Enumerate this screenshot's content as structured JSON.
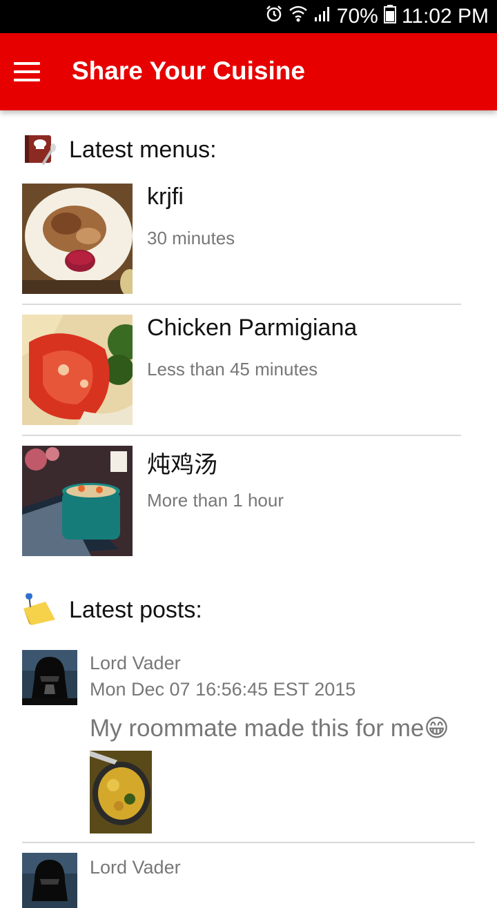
{
  "status_bar": {
    "battery": "70%",
    "time": "11:02 PM",
    "icons": [
      "alarm-icon",
      "wifi-icon",
      "signal-icon",
      "battery-icon"
    ]
  },
  "app_bar": {
    "title": "Share Your Cuisine",
    "color": "#e60000"
  },
  "menus_section": {
    "title": "Latest menus:",
    "icon": "recipe-book-icon",
    "items": [
      {
        "name": "krjfi",
        "time": "30 minutes"
      },
      {
        "name": "Chicken Parmigiana",
        "time": " Less than 45 minutes"
      },
      {
        "name": "炖鸡汤",
        "time": "More than 1 hour"
      }
    ]
  },
  "posts_section": {
    "title": "Latest posts:",
    "icon": "sticky-note-icon",
    "posts": [
      {
        "author": "Lord Vader",
        "date": "Mon Dec 07 16:56:45 EST 2015",
        "text": "My roommate made this for me😁"
      },
      {
        "author": "Lord Vader"
      }
    ]
  }
}
